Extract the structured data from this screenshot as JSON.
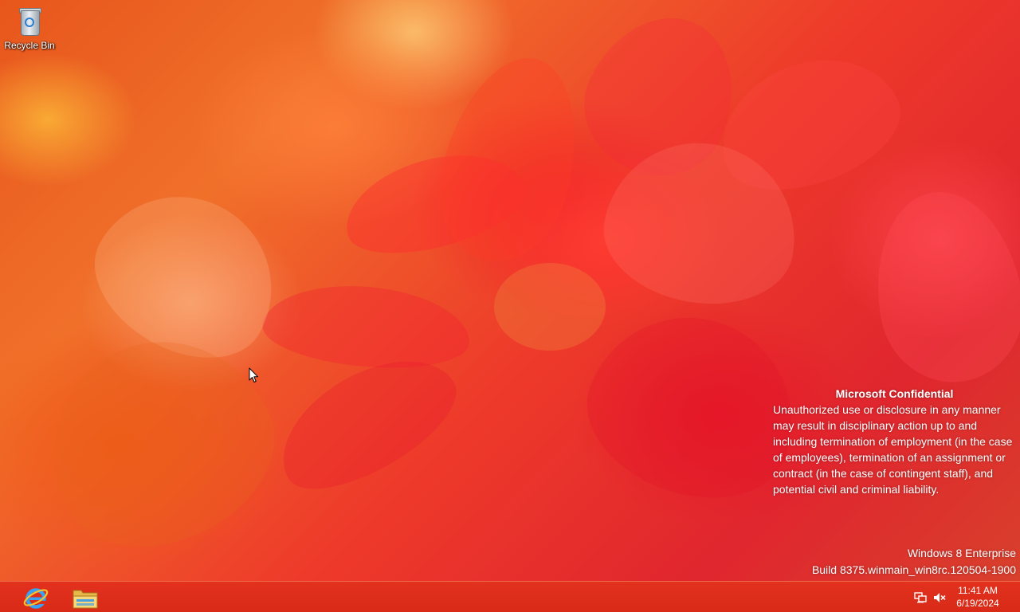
{
  "desktop": {
    "icons": [
      {
        "label": "Recycle Bin",
        "icon": "recycle-bin-icon"
      }
    ],
    "wallpaper": "red-flower-autumn-leaves"
  },
  "watermark": {
    "title": "Microsoft Confidential",
    "body": "Unauthorized use or disclosure in any manner may result in disciplinary action up to and including termination of employment (in the case of employees), termination of an assignment or contract (in the case of contingent staff), and potential civil and criminal liability."
  },
  "build_info": {
    "edition": "Windows 8 Enterprise",
    "build": "Build 8375.winmain_win8rc.120504-1900"
  },
  "taskbar": {
    "pinned": [
      {
        "name": "Internet Explorer",
        "icon": "internet-explorer-icon"
      },
      {
        "name": "File Explorer",
        "icon": "file-explorer-icon"
      }
    ],
    "tray": {
      "icons": [
        "network-icon",
        "volume-muted-icon"
      ],
      "time": "11:41 AM",
      "date": "6/19/2024"
    },
    "color": "#dd2e1b"
  }
}
